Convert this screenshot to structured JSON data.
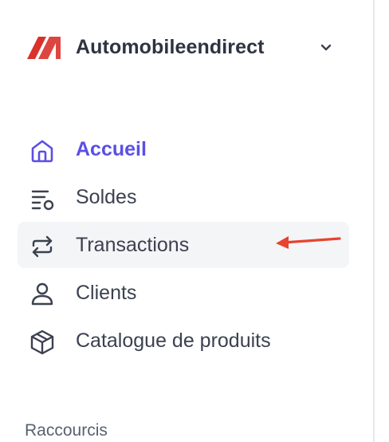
{
  "account": {
    "name": "Automobileendirect",
    "logo_icon": "brand-logo-icon",
    "chevron_icon": "chevron-down-icon"
  },
  "nav": {
    "items": [
      {
        "label": "Accueil",
        "icon": "home-icon",
        "selected": true
      },
      {
        "label": "Soldes",
        "icon": "balances-list-icon",
        "selected": false
      },
      {
        "label": "Transactions",
        "icon": "arrows-swap-icon",
        "selected": false,
        "highlighted": true
      },
      {
        "label": "Clients",
        "icon": "user-icon",
        "selected": false
      },
      {
        "label": "Catalogue de produits",
        "icon": "box-icon",
        "selected": false
      }
    ]
  },
  "shortcuts": {
    "title": "Raccourcis"
  },
  "colors": {
    "accent": "#5b4fe5",
    "text": "#3b4150",
    "hover_bg": "#f4f5f7",
    "annotation_arrow": "#e8432f",
    "logo_red": "#d9322b"
  }
}
